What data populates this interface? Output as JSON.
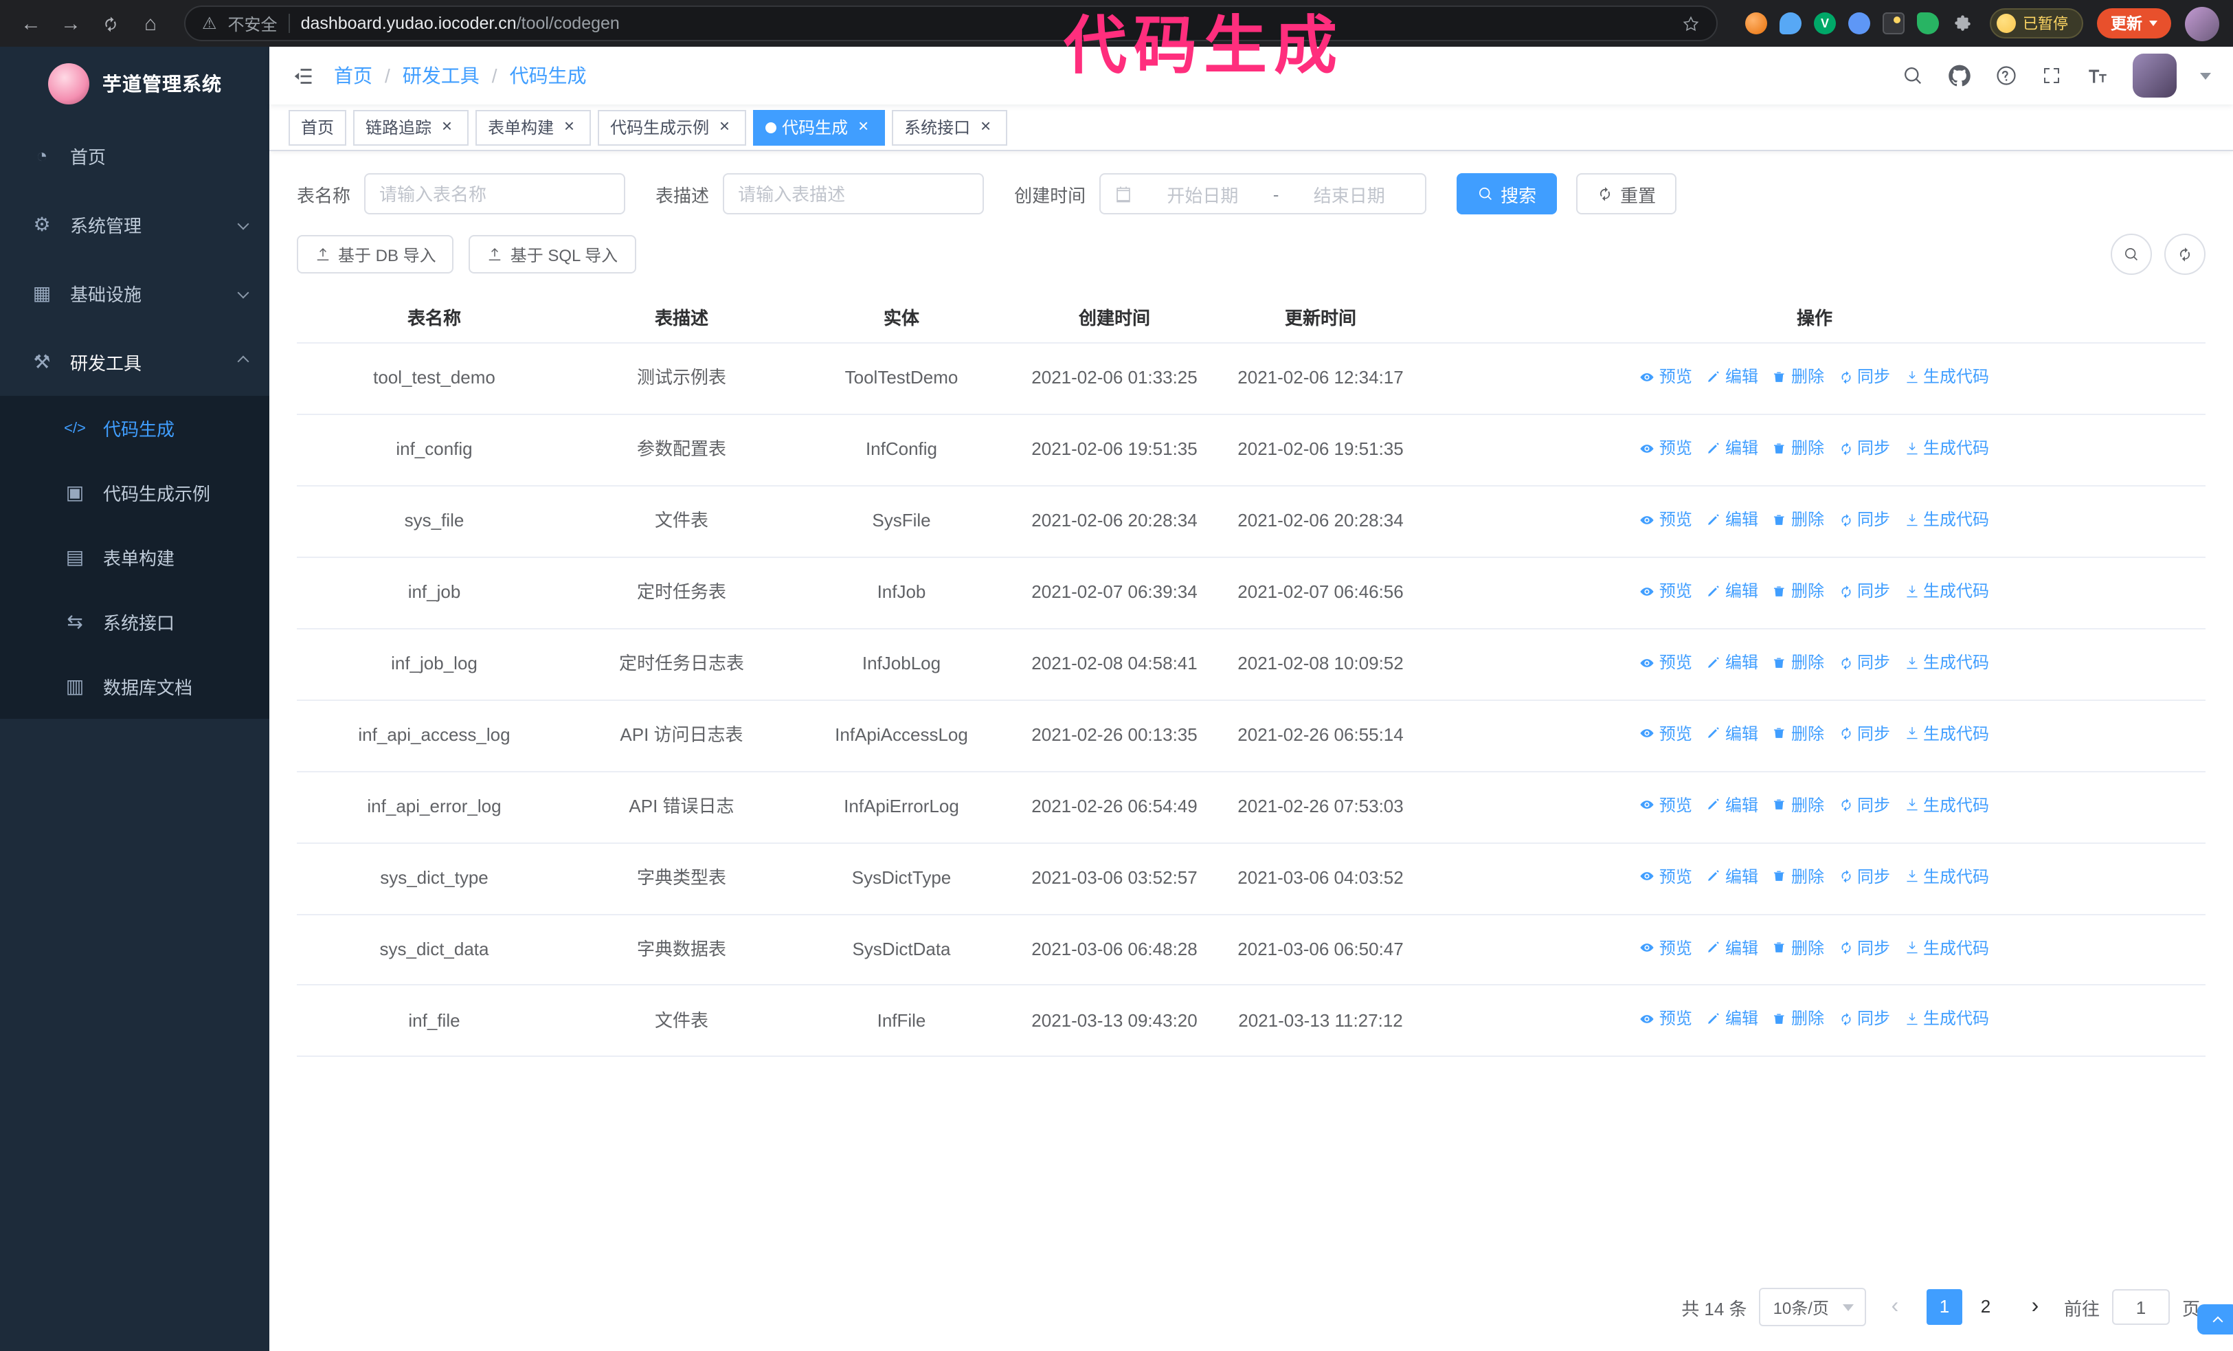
{
  "colors": {
    "accent": "#409eff",
    "annotation_pink": "#ff2e7d",
    "sidebar_bg": "#1d2b3a"
  },
  "browser": {
    "security_label": "不安全",
    "url_domain": "dashboard.yudao.iocoder.cn",
    "url_path": "/tool/codegen",
    "paused_badge": "已暂停",
    "update_button": "更新"
  },
  "annotation": {
    "text": "代码生成"
  },
  "sidebar": {
    "logo_title": "芋道管理系统",
    "items": [
      {
        "label": "首页"
      },
      {
        "label": "系统管理"
      },
      {
        "label": "基础设施"
      },
      {
        "label": "研发工具"
      }
    ],
    "submenu": [
      {
        "label": "代码生成"
      },
      {
        "label": "代码生成示例"
      },
      {
        "label": "表单构建"
      },
      {
        "label": "系统接口"
      },
      {
        "label": "数据库文档"
      }
    ]
  },
  "breadcrumb": [
    "首页",
    "研发工具",
    "代码生成"
  ],
  "tabs": [
    {
      "label": "首页",
      "closable": false,
      "active": false
    },
    {
      "label": "链路追踪",
      "closable": true,
      "active": false
    },
    {
      "label": "表单构建",
      "closable": true,
      "active": false
    },
    {
      "label": "代码生成示例",
      "closable": true,
      "active": false
    },
    {
      "label": "代码生成",
      "closable": true,
      "active": true
    },
    {
      "label": "系统接口",
      "closable": true,
      "active": false
    }
  ],
  "search_form": {
    "table_name_label": "表名称",
    "table_name_placeholder": "请输入表名称",
    "table_desc_label": "表描述",
    "table_desc_placeholder": "请输入表描述",
    "create_time_label": "创建时间",
    "start_placeholder": "开始日期",
    "separator": "-",
    "end_placeholder": "结束日期",
    "search_button": "搜索",
    "reset_button": "重置"
  },
  "toolbar": {
    "import_db_button": "基于 DB 导入",
    "import_sql_button": "基于 SQL 导入"
  },
  "table": {
    "columns": [
      "表名称",
      "表描述",
      "实体",
      "创建时间",
      "更新时间",
      "操作"
    ],
    "actions": [
      "预览",
      "编辑",
      "删除",
      "同步",
      "生成代码"
    ],
    "rows": [
      {
        "name": "tool_test_demo",
        "desc": "测试示例表",
        "entity": "ToolTestDemo",
        "created": "2021-02-06 01:33:25",
        "updated": "2021-02-06 12:34:17"
      },
      {
        "name": "inf_config",
        "desc": "参数配置表",
        "entity": "InfConfig",
        "created": "2021-02-06 19:51:35",
        "updated": "2021-02-06 19:51:35"
      },
      {
        "name": "sys_file",
        "desc": "文件表",
        "entity": "SysFile",
        "created": "2021-02-06 20:28:34",
        "updated": "2021-02-06 20:28:34"
      },
      {
        "name": "inf_job",
        "desc": "定时任务表",
        "entity": "InfJob",
        "created": "2021-02-07 06:39:34",
        "updated": "2021-02-07 06:46:56"
      },
      {
        "name": "inf_job_log",
        "desc": "定时任务日志表",
        "entity": "InfJobLog",
        "created": "2021-02-08 04:58:41",
        "updated": "2021-02-08 10:09:52"
      },
      {
        "name": "inf_api_access_log",
        "desc": "API 访问日志表",
        "entity": "InfApiAccessLog",
        "created": "2021-02-26 00:13:35",
        "updated": "2021-02-26 06:55:14"
      },
      {
        "name": "inf_api_error_log",
        "desc": "API 错误日志",
        "entity": "InfApiErrorLog",
        "created": "2021-02-26 06:54:49",
        "updated": "2021-02-26 07:53:03"
      },
      {
        "name": "sys_dict_type",
        "desc": "字典类型表",
        "entity": "SysDictType",
        "created": "2021-03-06 03:52:57",
        "updated": "2021-03-06 04:03:52"
      },
      {
        "name": "sys_dict_data",
        "desc": "字典数据表",
        "entity": "SysDictData",
        "created": "2021-03-06 06:48:28",
        "updated": "2021-03-06 06:50:47"
      },
      {
        "name": "inf_file",
        "desc": "文件表",
        "entity": "InfFile",
        "created": "2021-03-13 09:43:20",
        "updated": "2021-03-13 11:27:12"
      }
    ]
  },
  "pagination": {
    "total": "共 14 条",
    "page_size": "10条/页",
    "pages": [
      "1",
      "2"
    ],
    "active_page": "1",
    "goto_label": "前往",
    "goto_value": "1",
    "goto_unit": "页"
  }
}
